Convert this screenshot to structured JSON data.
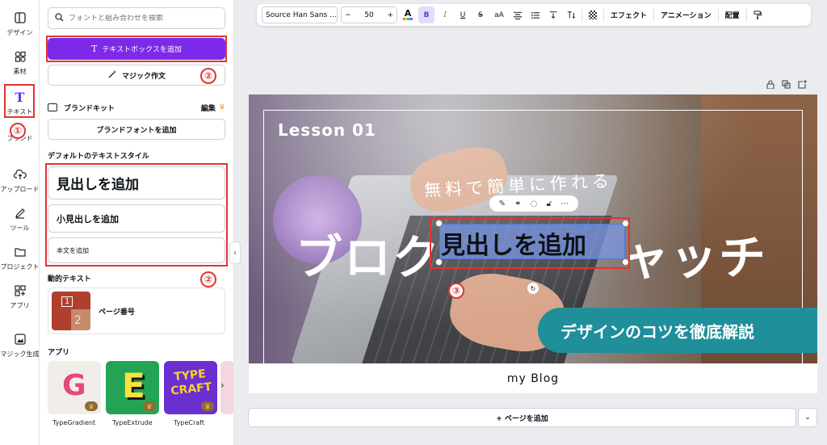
{
  "rail": {
    "items": [
      {
        "label": "デザイン",
        "icon": "layout-icon"
      },
      {
        "label": "素材",
        "icon": "shapes-icon"
      },
      {
        "label": "テキスト",
        "icon": "text-icon"
      },
      {
        "label": "ブランド",
        "icon": "brand-icon"
      },
      {
        "label": "アップロード",
        "icon": "upload-icon"
      },
      {
        "label": "ツール",
        "icon": "pen-icon"
      },
      {
        "label": "プロジェクト",
        "icon": "folder-icon"
      },
      {
        "label": "アプリ",
        "icon": "apps-icon"
      },
      {
        "label": "マジック生成",
        "icon": "magic-icon"
      }
    ]
  },
  "panel": {
    "search_placeholder": "フォントと組み合わせを検索",
    "add_textbox": "テキストボックスを追加",
    "magic_write": "マジック作文",
    "brand_kit": "ブランドキット",
    "brand_kit_edit": "編集",
    "add_brand_font": "ブランドフォントを追加",
    "default_styles_title": "デフォルトのテキストスタイル",
    "heading": "見出しを追加",
    "subheading": "小見出しを追加",
    "body": "本文を追加",
    "dynamic_text_title": "動的テキスト",
    "page_number": "ページ番号",
    "thumb_num_1": "1",
    "thumb_num_2": "2",
    "apps_title": "アプリ",
    "apps": [
      {
        "label": "TypeGradient",
        "glyph": "G"
      },
      {
        "label": "TypeExtrude",
        "glyph": "E"
      },
      {
        "label": "TypeCraft",
        "glyph": "TYPE CRAFT"
      }
    ]
  },
  "annotations": {
    "n1": "①",
    "n2": "②",
    "n3": "③"
  },
  "toolbar": {
    "font": "Source Han Sans ...",
    "minus": "−",
    "size": "50",
    "plus": "+",
    "color_glyph": "A",
    "bold": "B",
    "italic": "I",
    "underline": "U",
    "strike": "S",
    "case": "aA",
    "effects": "エフェクト",
    "animation": "アニメーション",
    "position": "配置"
  },
  "canvas": {
    "lesson": "Lesson 01",
    "subtitle": "無料で簡単に作れる",
    "big_left": "ブロク",
    "big_right": "ャッチ",
    "selected_text": "見出しを追加",
    "banner": "デザインのコツを徹底解説",
    "footer": "my Blog"
  },
  "add_page": "+ ページを追加",
  "colors": {
    "accent": "#7d2ae8",
    "annotation_red": "#e03434",
    "banner_teal": "#1f8f9a"
  }
}
